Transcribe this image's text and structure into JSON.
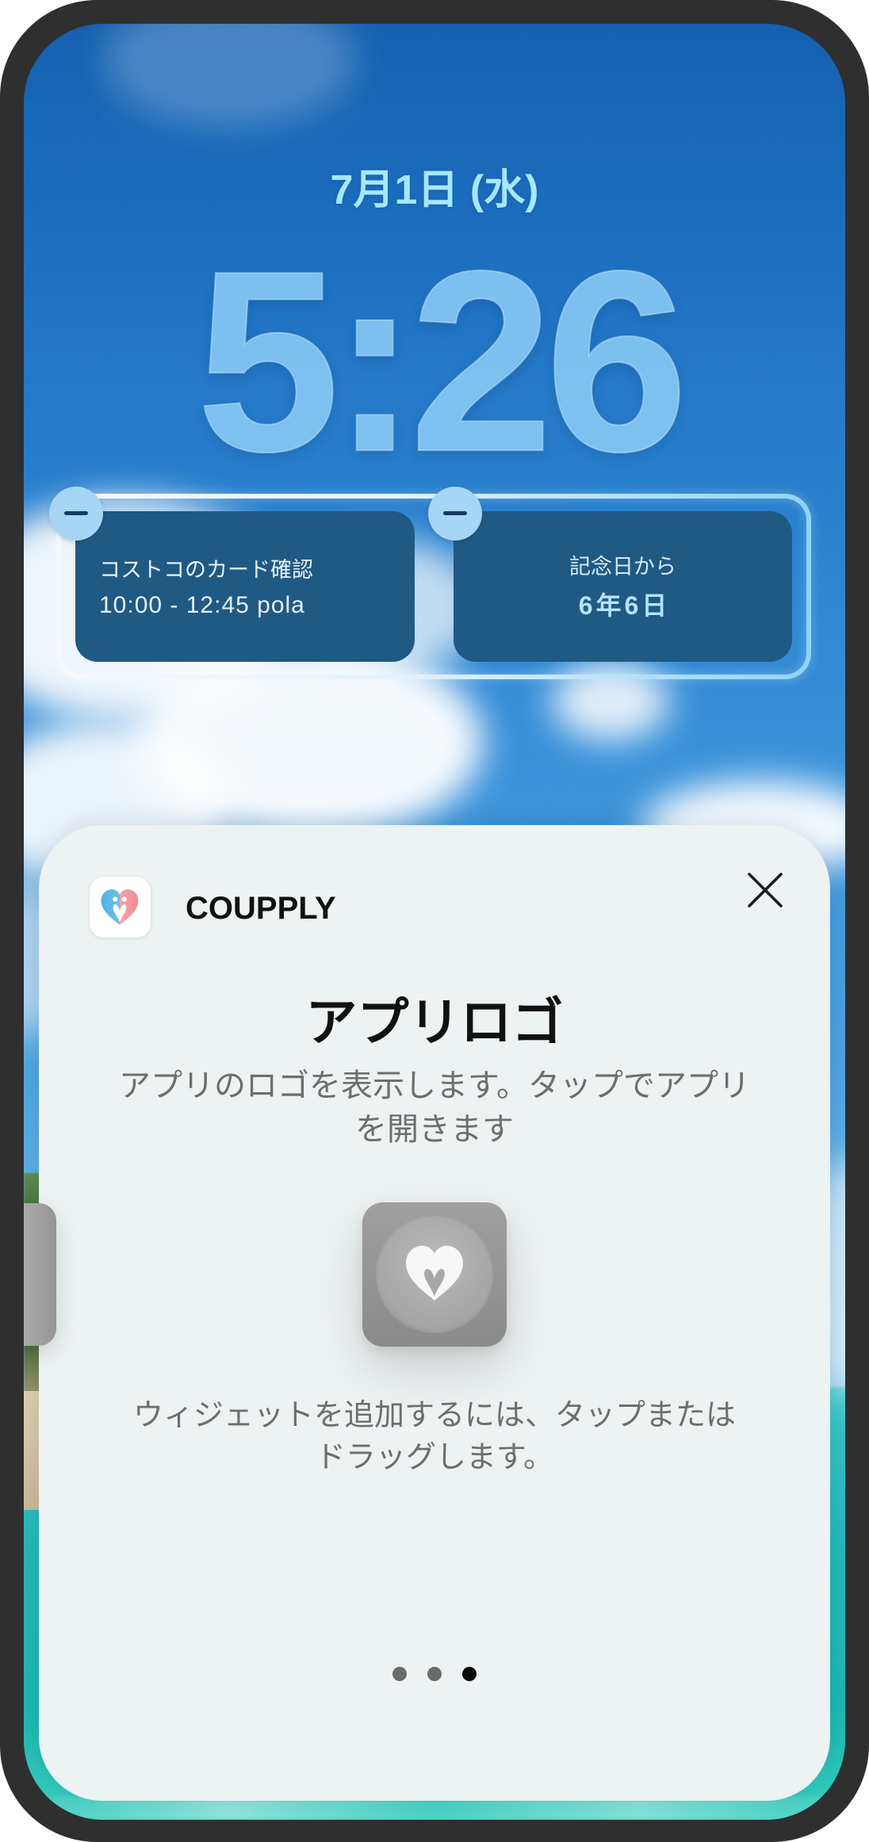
{
  "lock_screen": {
    "date": "7月1日 (水)",
    "time": "5:26",
    "widgets": [
      {
        "title": "コストコのカード確認",
        "detail": "10:00 - 12:45 pola"
      },
      {
        "title": "記念日から",
        "detail": "6年6日"
      }
    ]
  },
  "widget_gallery": {
    "app_name": "COUPPLY",
    "title": "アプリロゴ",
    "description": "アプリのロゴを表示します。タップでアプリを開きます",
    "instruction": "ウィジェットを追加するには、タップまたはドラッグします。",
    "page_indicator": {
      "total": 3,
      "active_index": 2
    }
  },
  "icons": {
    "remove_widget": "minus-icon",
    "close": "close-icon",
    "app_logo": "coupply-logo-icon",
    "widget_preview": "heart-logo-icon"
  },
  "colors": {
    "date_text": "#a6e8ff",
    "time_text": "#86c9f4",
    "widget_bg": "#1f5a85",
    "remove_button": "#a6d6f4",
    "sheet_bg": "#edf2f3",
    "secondary_text": "#6e6e6e",
    "page_dot_inactive": "#6b6b6b",
    "page_dot_active": "#0a0a0a"
  }
}
